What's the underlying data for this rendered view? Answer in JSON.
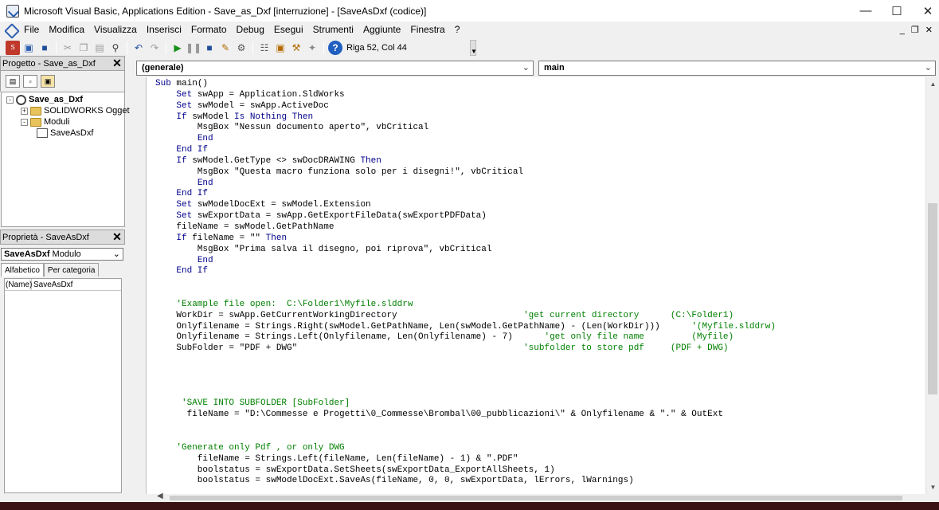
{
  "window": {
    "title": "Microsoft Visual Basic, Applications Edition - Save_as_Dxf [interruzione] - [SaveAsDxf (codice)]"
  },
  "menu": [
    "File",
    "Modifica",
    "Visualizza",
    "Inserisci",
    "Formato",
    "Debug",
    "Esegui",
    "Strumenti",
    "Aggiunte",
    "Finestra",
    "?"
  ],
  "toolbar": {
    "position": "Riga 52, Col 44"
  },
  "project": {
    "header": "Progetto - Save_as_Dxf",
    "root": "Save_as_Dxf",
    "node1": "SOLIDWORKS Oggetti",
    "node2": "Moduli",
    "leaf": "SaveAsDxf"
  },
  "properties": {
    "header": "Proprietà - SaveAsDxf",
    "object_name": "SaveAsDxf",
    "object_type": "Modulo",
    "tabs": [
      "Alfabetico",
      "Per categoria"
    ],
    "row_key": "(Name)",
    "row_value": "SaveAsDxf"
  },
  "code": {
    "object_combo": "(generale)",
    "proc_combo": "main",
    "lines": [
      [
        [
          "k",
          "Sub"
        ],
        [
          "t",
          " main()"
        ]
      ],
      [
        [
          "t",
          "    "
        ],
        [
          "k",
          "Set"
        ],
        [
          "t",
          " swApp = Application.SldWorks"
        ]
      ],
      [
        [
          "t",
          "    "
        ],
        [
          "k",
          "Set"
        ],
        [
          "t",
          " swModel = swApp.ActiveDoc"
        ]
      ],
      [
        [
          "t",
          "    "
        ],
        [
          "k",
          "If"
        ],
        [
          "t",
          " swModel "
        ],
        [
          "k",
          "Is Nothing Then"
        ]
      ],
      [
        [
          "t",
          "        MsgBox \"Nessun documento aperto\", vbCritical"
        ]
      ],
      [
        [
          "t",
          "        "
        ],
        [
          "k",
          "End"
        ]
      ],
      [
        [
          "t",
          "    "
        ],
        [
          "k",
          "End If"
        ]
      ],
      [
        [
          "t",
          "    "
        ],
        [
          "k",
          "If"
        ],
        [
          "t",
          " swModel.GetType <> swDocDRAWING "
        ],
        [
          "k",
          "Then"
        ]
      ],
      [
        [
          "t",
          "        MsgBox \"Questa macro funziona solo per i disegni!\", vbCritical"
        ]
      ],
      [
        [
          "t",
          "        "
        ],
        [
          "k",
          "End"
        ]
      ],
      [
        [
          "t",
          "    "
        ],
        [
          "k",
          "End If"
        ]
      ],
      [
        [
          "t",
          "    "
        ],
        [
          "k",
          "Set"
        ],
        [
          "t",
          " swModelDocExt = swModel.Extension"
        ]
      ],
      [
        [
          "t",
          "    "
        ],
        [
          "k",
          "Set"
        ],
        [
          "t",
          " swExportData = swApp.GetExportFileData(swExportPDFData)"
        ]
      ],
      [
        [
          "t",
          "    fileName = swModel.GetPathName"
        ]
      ],
      [
        [
          "t",
          "    "
        ],
        [
          "k",
          "If"
        ],
        [
          "t",
          " fileName = \"\" "
        ],
        [
          "k",
          "Then"
        ]
      ],
      [
        [
          "t",
          "        MsgBox \"Prima salva il disegno, poi riprova\", vbCritical"
        ]
      ],
      [
        [
          "t",
          "        "
        ],
        [
          "k",
          "End"
        ]
      ],
      [
        [
          "t",
          "    "
        ],
        [
          "k",
          "End If"
        ]
      ],
      [],
      [],
      [
        [
          "t",
          "    "
        ],
        [
          "c",
          "'Example file open:  C:\\Folder1\\Myfile.slddrw"
        ]
      ],
      [
        [
          "t",
          "    WorkDir = swApp.GetCurrentWorkingDirectory                        "
        ],
        [
          "c",
          "'get current directory      (C:\\Folder1)"
        ]
      ],
      [
        [
          "t",
          "    Onlyfilename = Strings.Right(swModel.GetPathName, Len(swModel.GetPathName) - (Len(WorkDir)))      "
        ],
        [
          "c",
          "'(Myfile.slddrw)"
        ]
      ],
      [
        [
          "t",
          "    Onlyfilename = Strings.Left(Onlyfilename, Len(Onlyfilename) - 7)      "
        ],
        [
          "c",
          "'get only file name         (Myfile)"
        ]
      ],
      [
        [
          "t",
          "    SubFolder = \"PDF + DWG\"                                           "
        ],
        [
          "c",
          "'subfolder to store pdf     (PDF + DWG)"
        ]
      ],
      [],
      [],
      [],
      [],
      [
        [
          "t",
          "     "
        ],
        [
          "c",
          "'SAVE INTO SUBFOLDER [SubFolder]"
        ]
      ],
      [
        [
          "t",
          "      fileName = \"D:\\Commesse e Progetti\\0_Commesse\\Brombal\\00_pubblicazioni\\\" & Onlyfilename & \".\" & OutExt"
        ]
      ],
      [],
      [],
      [
        [
          "t",
          "    "
        ],
        [
          "c",
          "'Generate only Pdf , or only DWG"
        ]
      ],
      [
        [
          "t",
          "        fileName = Strings.Left(fileName, Len(fileName) - 1) & \".PDF\""
        ]
      ],
      [
        [
          "t",
          "        boolstatus = swExportData.SetSheets(swExportData_ExportAllSheets, 1)"
        ]
      ],
      [
        [
          "t",
          "        boolstatus = swModelDocExt.SaveAs(fileName, 0, 0, swExportData, lErrors, lWarnings)"
        ]
      ]
    ]
  }
}
